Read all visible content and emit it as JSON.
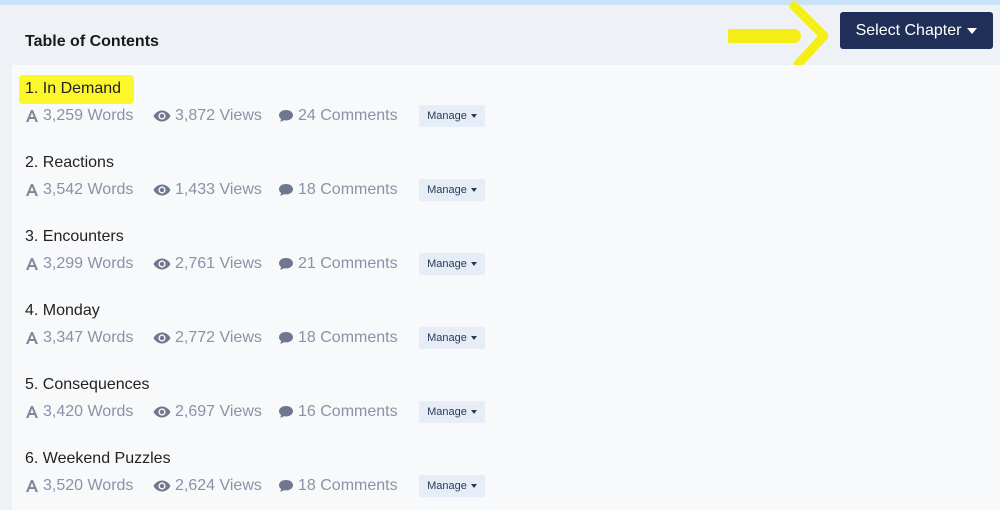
{
  "header": {
    "title": "Table of Contents",
    "select_chapter_label": "Select Chapter"
  },
  "colors": {
    "primary_button": "#1f2f57",
    "highlight": "#fbf72a",
    "muted_text": "#8a92a6",
    "manage_bg": "#e6edf6"
  },
  "chapters": [
    {
      "title": "1. In Demand",
      "words": "3,259 Words",
      "views": "3,872 Views",
      "comments": "24 Comments",
      "manage_label": "Manage",
      "highlighted": true
    },
    {
      "title": "2. Reactions",
      "words": "3,542 Words",
      "views": "1,433 Views",
      "comments": "18 Comments",
      "manage_label": "Manage"
    },
    {
      "title": "3. Encounters",
      "words": "3,299 Words",
      "views": "2,761 Views",
      "comments": "21 Comments",
      "manage_label": "Manage"
    },
    {
      "title": "4. Monday",
      "words": "3,347 Words",
      "views": "2,772 Views",
      "comments": "18 Comments",
      "manage_label": "Manage"
    },
    {
      "title": "5. Consequences",
      "words": "3,420 Words",
      "views": "2,697 Views",
      "comments": "16 Comments",
      "manage_label": "Manage"
    },
    {
      "title": "6. Weekend Puzzles",
      "words": "3,520 Words",
      "views": "2,624 Views",
      "comments": "18 Comments",
      "manage_label": "Manage"
    }
  ],
  "icons": {
    "words": "font-size-icon",
    "views": "eye-icon",
    "comments": "comment-bubble-icon",
    "caret": "caret-down-icon"
  }
}
